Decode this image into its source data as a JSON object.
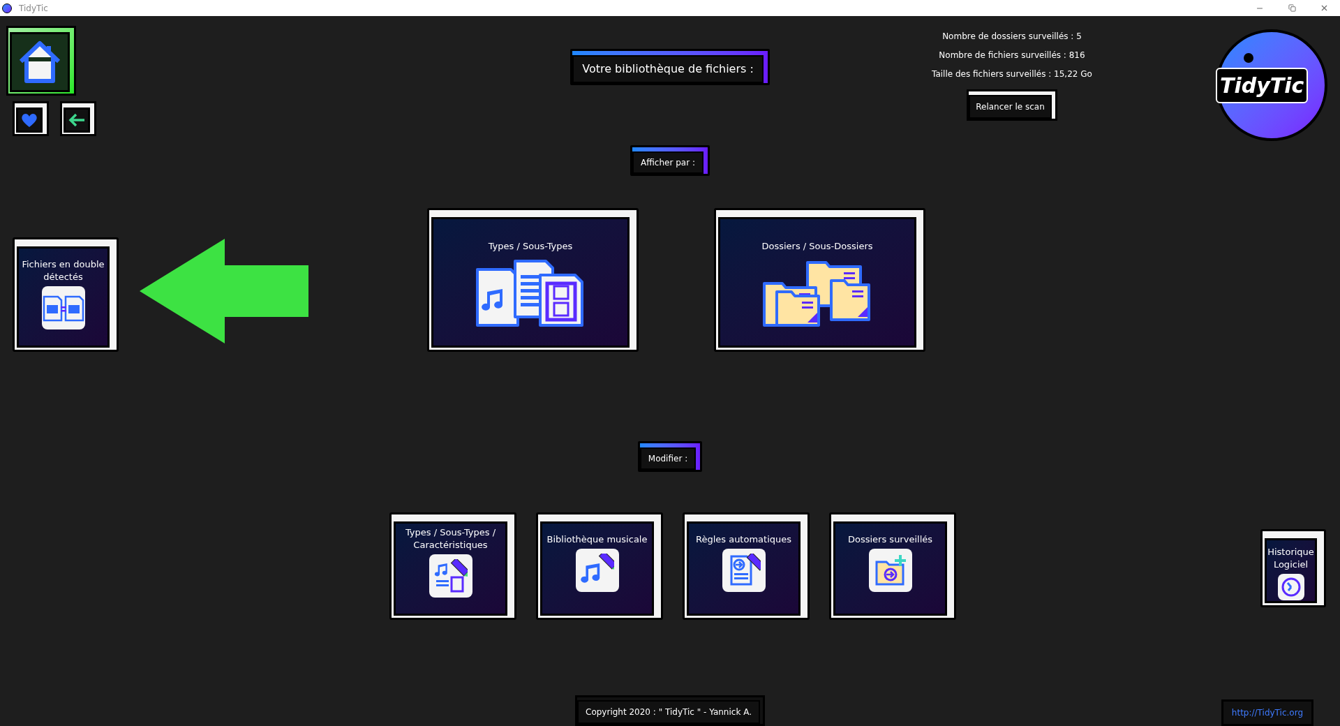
{
  "window": {
    "title": "TidyTic"
  },
  "nav_buttons": [
    {
      "kind": "home",
      "selected": true
    },
    {
      "kind": "favorites",
      "selected": false
    },
    {
      "kind": "back",
      "selected": false
    }
  ],
  "header": {
    "title": "Votre bibliothèque de fichiers :"
  },
  "stats": [
    "Nombre de dossiers surveillés : 5",
    "Nombre de fichiers surveillés : 816",
    "Taille des fichiers surveillés : 15,22 Go"
  ],
  "rescan_button": "Relancer le scan",
  "logo_text": "TidyTic",
  "view_section": {
    "label": "Afficher par :",
    "options": [
      {
        "label": "Types / Sous-Types",
        "kind": "types"
      },
      {
        "label": "Dossiers / Sous-Dossiers",
        "kind": "folders"
      }
    ]
  },
  "duplicates": {
    "label": "Fichiers en double détectés"
  },
  "edit_section": {
    "label": "Modifier :",
    "options": [
      {
        "label": "Types / Sous-Types / Caractéristiques",
        "kind": "types-edit"
      },
      {
        "label": "Bibliothèque musicale",
        "kind": "music-edit"
      },
      {
        "label": "Règles automatiques",
        "kind": "rules-edit"
      },
      {
        "label": "Dossiers surveillés",
        "kind": "folders-edit"
      }
    ]
  },
  "history": {
    "label": "Historique Logiciel"
  },
  "footer": {
    "copyright": "Copyright 2020 : \" TidyTic \" - Yannick A.",
    "link": "http://TidyTic.org"
  }
}
